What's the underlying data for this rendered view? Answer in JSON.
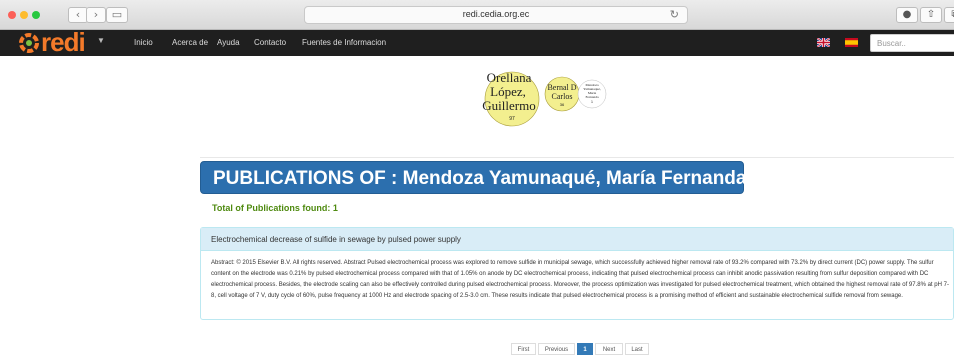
{
  "browser": {
    "url": "redi.cedia.org.ec"
  },
  "navbar": {
    "logo": "redi",
    "links": [
      "Inicio",
      "Acerca de",
      "Ayuda",
      "Contacto",
      "Fuentes de Informacion"
    ],
    "flags": [
      "english-flag",
      "spanish-flag"
    ],
    "search_placeholder": "Buscar.."
  },
  "cloud": {
    "main_name": [
      "Orellana",
      "López,",
      "Guillermo"
    ],
    "main_count": "97",
    "second_name": [
      "Bernal D",
      "Carlos"
    ],
    "second_count": "36",
    "third_name": [
      "Mendoza",
      "Yamunaqué,",
      "María",
      "Fernanda"
    ],
    "third_count": "1"
  },
  "main": {
    "title": "PUBLICATIONS OF : Mendoza Yamunaqué, María Fernanda",
    "total": "Total of Publications found: 1"
  },
  "publication": {
    "title": "Electrochemical decrease of sulfide in sewage by pulsed power supply",
    "abstract": "Abstract: © 2015 Elsevier B.V. All rights reserved. Abstract Pulsed electrochemical process was explored to remove sulfide in municipal sewage, which successfully achieved higher removal rate of 93.2% compared with 73.2% by direct current (DC) power supply. The sulfur content on the electrode was 0.21% by pulsed electrochemical process compared with that of 1.05% on anode by DC electrochemical process, indicating that pulsed electrochemical process can inhibit anodic passivation resulting from sulfur deposition compared with DC electrochemical process. Besides, the electrode scaling can also be effectively controlled during pulsed electrochemical process. Moreover, the process optimization was investigated for pulsed electrochemical treatment, which obtained the highest removal rate of 97.8% at pH 7-8, cell voltage of 7 V, duty cycle of 60%, pulse frequency at 1000 Hz and electrode spacing of 2.5-3.0 cm. These results indicate that pulsed electrochemical process is a promising method of efficient and sustainable electrochemical sulfide removal from sewage."
  },
  "pagination": {
    "first": "First",
    "previous": "Previous",
    "current": "1",
    "next": "Next",
    "last": "Last"
  }
}
